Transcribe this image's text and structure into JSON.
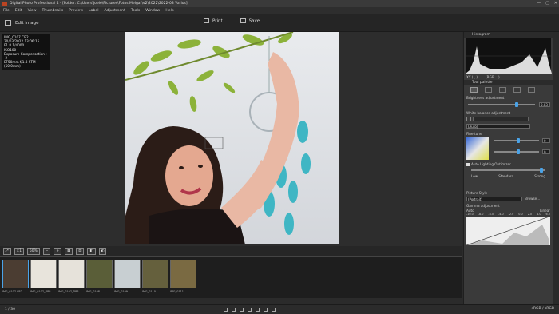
{
  "window": {
    "title": "Digital Photo Professional 4 - [Folder: C:\\Users\\joele\\Pictures\\Fotos Melgar\\v2\\2022\\2022-03 Varios]",
    "controls": [
      "—",
      "▢",
      "✕"
    ]
  },
  "menu": [
    "File",
    "Edit",
    "View",
    "Thumbnails",
    "Preview",
    "Label",
    "Adjustment",
    "Tools",
    "Window",
    "Help"
  ],
  "toolbar": {
    "edit_label": "Edit image",
    "print_label": "Print",
    "save_label": "Save"
  },
  "info": {
    "lines": [
      "IMG_0107.CR2",
      "20/03/2022 13:06:15",
      "F1.8 1/4000",
      "ISO100",
      "Exposure Compensation : -2",
      "EF50mm f/1.8 STM (50.0mm)"
    ]
  },
  "rightpanel": {
    "histogram_label": "Histogram",
    "xy_label": "XY ( , )",
    "rgb_label": "(RGB ...)",
    "tool_palette_label": "Tool palette",
    "brightness_label": "Brightness adjustment",
    "brightness_value": "0.83",
    "wb_label": "White balance adjustment",
    "wb_value": "(Auto)",
    "finetune_label": "Fine-tune",
    "ft_b": "0",
    "ft_g": "0",
    "alo_label": "Auto Lighting Optimizer",
    "alo_levels": [
      "Low",
      "Standard",
      "Strong"
    ],
    "picture_style_label": "Picture Style",
    "picture_style_value": "(Portrait)",
    "browse_label": "Browse...",
    "gamma_label": "Gamma adjustment",
    "auto_label": "Auto",
    "linear_label": "Linear",
    "gamma_ticks": [
      "-10.0",
      "-8.0",
      "-6.0",
      "-4.0",
      "-2.0",
      "0.0",
      "2.0",
      "4.0",
      "6.0"
    ]
  },
  "bottombar": {
    "zoom": "50%",
    "fit": "⤢",
    "one": "×1"
  },
  "filmstrip": {
    "thumbs": [
      {
        "name": "IMG_0107.CR2"
      },
      {
        "name": "IMG_0107_DPP"
      },
      {
        "name": "IMG_0107_DPP"
      },
      {
        "name": "IMG_0108"
      },
      {
        "name": "IMG_0109"
      },
      {
        "name": "IMG_0110"
      },
      {
        "name": "IMG_0111"
      }
    ]
  },
  "status": {
    "count": "1 / 30",
    "colorspace": "sRGB / sRGB"
  },
  "colors": {
    "accent": "#4aa3e8",
    "bg": "#2b2b2b"
  }
}
